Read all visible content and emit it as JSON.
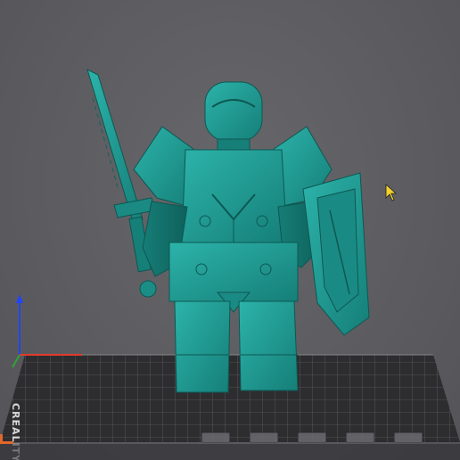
{
  "viewport": {
    "bed_brand": "CREALITY",
    "model_color": "#1d9a92",
    "background_color": "#5f5f63",
    "axis_colors": {
      "z": "#2244ff",
      "x": "#e33b2c",
      "y": "#2fa336"
    }
  },
  "icons": {
    "cursor": "mouse-pointer-icon"
  },
  "toolbar": {
    "buttons": [
      "move-view-button",
      "rotate-view-button",
      "zoom-view-button",
      "fit-view-button",
      "top-view-button",
      "front-view-button"
    ]
  }
}
